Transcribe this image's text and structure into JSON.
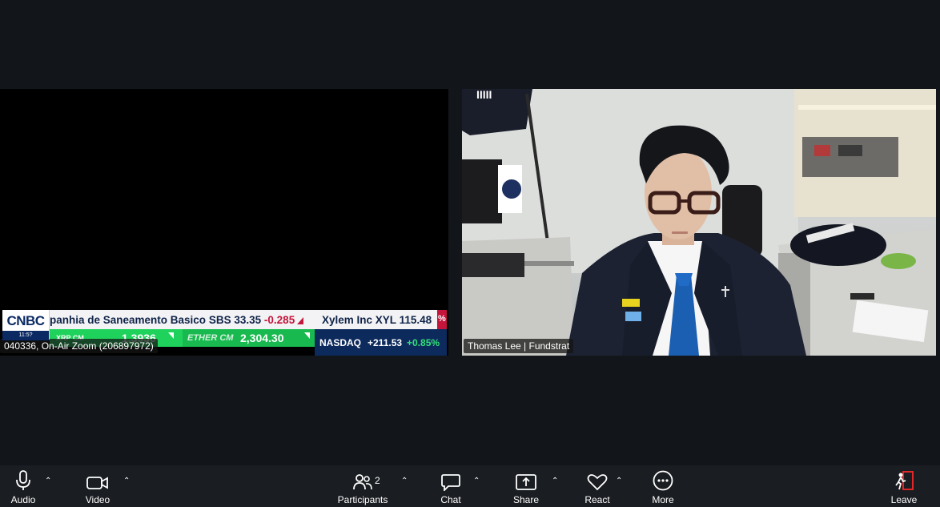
{
  "left_tile": {
    "ticker_top": {
      "logo": "CNBC",
      "logo_clock": "11:5?",
      "item1_name": "panhia de Saneamento Basico",
      "item1_symbol": "SBS",
      "item1_price": "33.35",
      "item1_change": "-0.285",
      "item2_name": "Xylem Inc",
      "item2_symbol": "XYL",
      "item2_price": "115.48",
      "item2_change": "%"
    },
    "ticker_bottom": {
      "seg1": "XRP CM",
      "seg1_value": "1.3936",
      "seg2": "ETHER CM",
      "seg2_value": "2,304.30",
      "nasdaq_label": "NASDAQ",
      "nasdaq_change": "+211.53",
      "nasdaq_pct": "+0.85%"
    },
    "name_tag": "040336, On-Air Zoom (206897972)"
  },
  "right_tile": {
    "name_tag": "Thomas Lee | Fundstrat",
    "banner_text": "IIIII"
  },
  "toolbar": {
    "audio": "Audio",
    "video": "Video",
    "participants": "Participants",
    "participants_count": "2",
    "chat": "Chat",
    "share": "Share",
    "react": "React",
    "more": "More",
    "leave": "Leave"
  },
  "colors": {
    "background": "#12161b",
    "toolbar": "#1a1d21",
    "ticker_green": "#1fd25c",
    "ticker_red": "#c4153a",
    "ticker_navy": "#0d2a5c",
    "leave_red": "#e02828"
  }
}
